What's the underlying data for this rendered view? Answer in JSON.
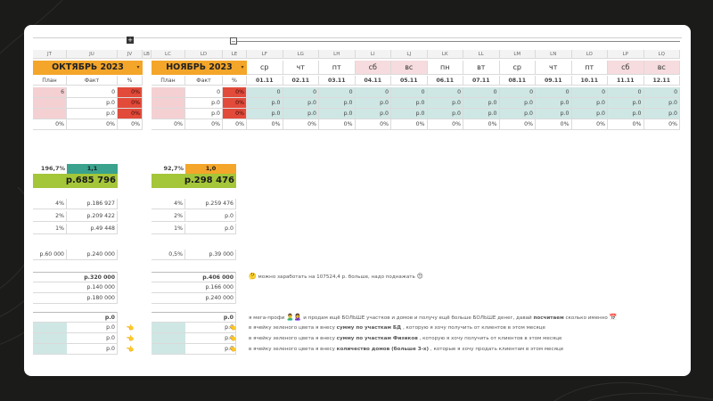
{
  "col_letters": {
    "jt": "JT",
    "ju": "JU",
    "jv": "JV",
    "lb": "LB",
    "lc": "LC",
    "ld": "LD",
    "le": "LE",
    "days": [
      "LF",
      "LG",
      "LH",
      "LI",
      "LJ",
      "LK",
      "LL",
      "LM",
      "LN",
      "LO",
      "LP",
      "LQ"
    ]
  },
  "outline": {
    "expand": "+",
    "collapse": "−"
  },
  "october": {
    "month": "ОКТЯБРЬ 2023",
    "plan": "План",
    "fact": "Факт",
    "pct": "%",
    "rows": [
      [
        "6",
        "0",
        "0%"
      ],
      [
        "",
        "р.0",
        "0%"
      ],
      [
        "",
        "р.0",
        "0%"
      ],
      [
        "0%",
        "0%",
        "0%"
      ]
    ]
  },
  "november": {
    "month": "НОЯБРЬ 2023",
    "plan": "План",
    "fact": "Факт",
    "pct": "%",
    "rows": [
      [
        "",
        "0",
        "0%"
      ],
      [
        "",
        "р.0",
        "0%"
      ],
      [
        "",
        "р.0",
        "0%"
      ],
      [
        "0%",
        "0%",
        "0%"
      ]
    ]
  },
  "days": [
    {
      "dow": "ср",
      "date": "01.11",
      "weekend": false
    },
    {
      "dow": "чт",
      "date": "02.11",
      "weekend": false
    },
    {
      "dow": "пт",
      "date": "03.11",
      "weekend": false
    },
    {
      "dow": "сб",
      "date": "04.11",
      "weekend": true
    },
    {
      "dow": "вс",
      "date": "05.11",
      "weekend": true
    },
    {
      "dow": "пн",
      "date": "06.11",
      "weekend": false
    },
    {
      "dow": "вт",
      "date": "07.11",
      "weekend": false
    },
    {
      "dow": "ср",
      "date": "08.11",
      "weekend": false
    },
    {
      "dow": "чт",
      "date": "09.11",
      "weekend": false
    },
    {
      "dow": "пт",
      "date": "10.11",
      "weekend": false
    },
    {
      "dow": "сб",
      "date": "11.11",
      "weekend": true
    },
    {
      "dow": "вс",
      "date": "12.11",
      "weekend": true
    }
  ],
  "day_rows": [
    "0",
    "р.0",
    "р.0",
    "0%"
  ],
  "oct_summary": {
    "pct": "196,7%",
    "ratio": "1,1",
    "total": "р.685 796",
    "split": [
      [
        "4%",
        "р.186 927"
      ],
      [
        "2%",
        "р.209 422"
      ],
      [
        "1%",
        "р.49 448"
      ]
    ],
    "extra": [
      "р.60 000",
      "р.240 000"
    ],
    "goals": [
      "р.320 000",
      "р.140 000",
      "р.180 000"
    ],
    "mini": [
      "р.0",
      "р.0",
      "р.0",
      "р.0"
    ]
  },
  "nov_summary": {
    "pct": "92,7%",
    "ratio": "1,0",
    "total": "р.298 476",
    "split": [
      [
        "4%",
        "р.259 476"
      ],
      [
        "2%",
        "р.0"
      ],
      [
        "1%",
        "р.0"
      ]
    ],
    "extra": [
      "0,5%",
      "р.39 000"
    ],
    "goals": [
      "р.406 000",
      "р.166 000",
      "р.240 000"
    ],
    "mini": [
      "р.0",
      "р.0",
      "р.0",
      "р.0"
    ]
  },
  "notes": {
    "earn": {
      "icon": "🤔",
      "text": "можно заработать на 107524,4 р. больше, надо поднажать",
      "tail": "😍"
    },
    "pro": {
      "a": "я мега-профи",
      "icons": "🙎‍♂️🙎‍♀️",
      "b": "и продам ещё БОЛЬШЕ участков и домов и получу ещё больше БОЛЬШЕ денег, давай",
      "bold": "посчитаем",
      "c": "сколько именно",
      "end": "📅"
    },
    "hint_icon": "👈",
    "lines": [
      {
        "a": "в ячейку зеленого цвета я внесу",
        "bold": "сумму по участкам БД",
        "c": ", которую я хочу получить от клиентов в этом месяце"
      },
      {
        "a": "в ячейку зеленого цвета я внесу",
        "bold": "сумму по участкам Физиков",
        "c": ", которую я хочу получить от клиентов в этом месяце"
      },
      {
        "a": "в ячейку зеленого цвета я внесу",
        "bold": "количество домов (больше 3-х)",
        "c": ", которые я хочу продать клиентам в этом месяце"
      }
    ]
  },
  "colors": {
    "orange": "#f4a62a",
    "red": "#e24a3a",
    "green": "#a4c639",
    "teal": "#3aa28d",
    "pink": "#f4d0d3",
    "mint": "#cfe7e4",
    "bg": "#1b1c1a"
  }
}
